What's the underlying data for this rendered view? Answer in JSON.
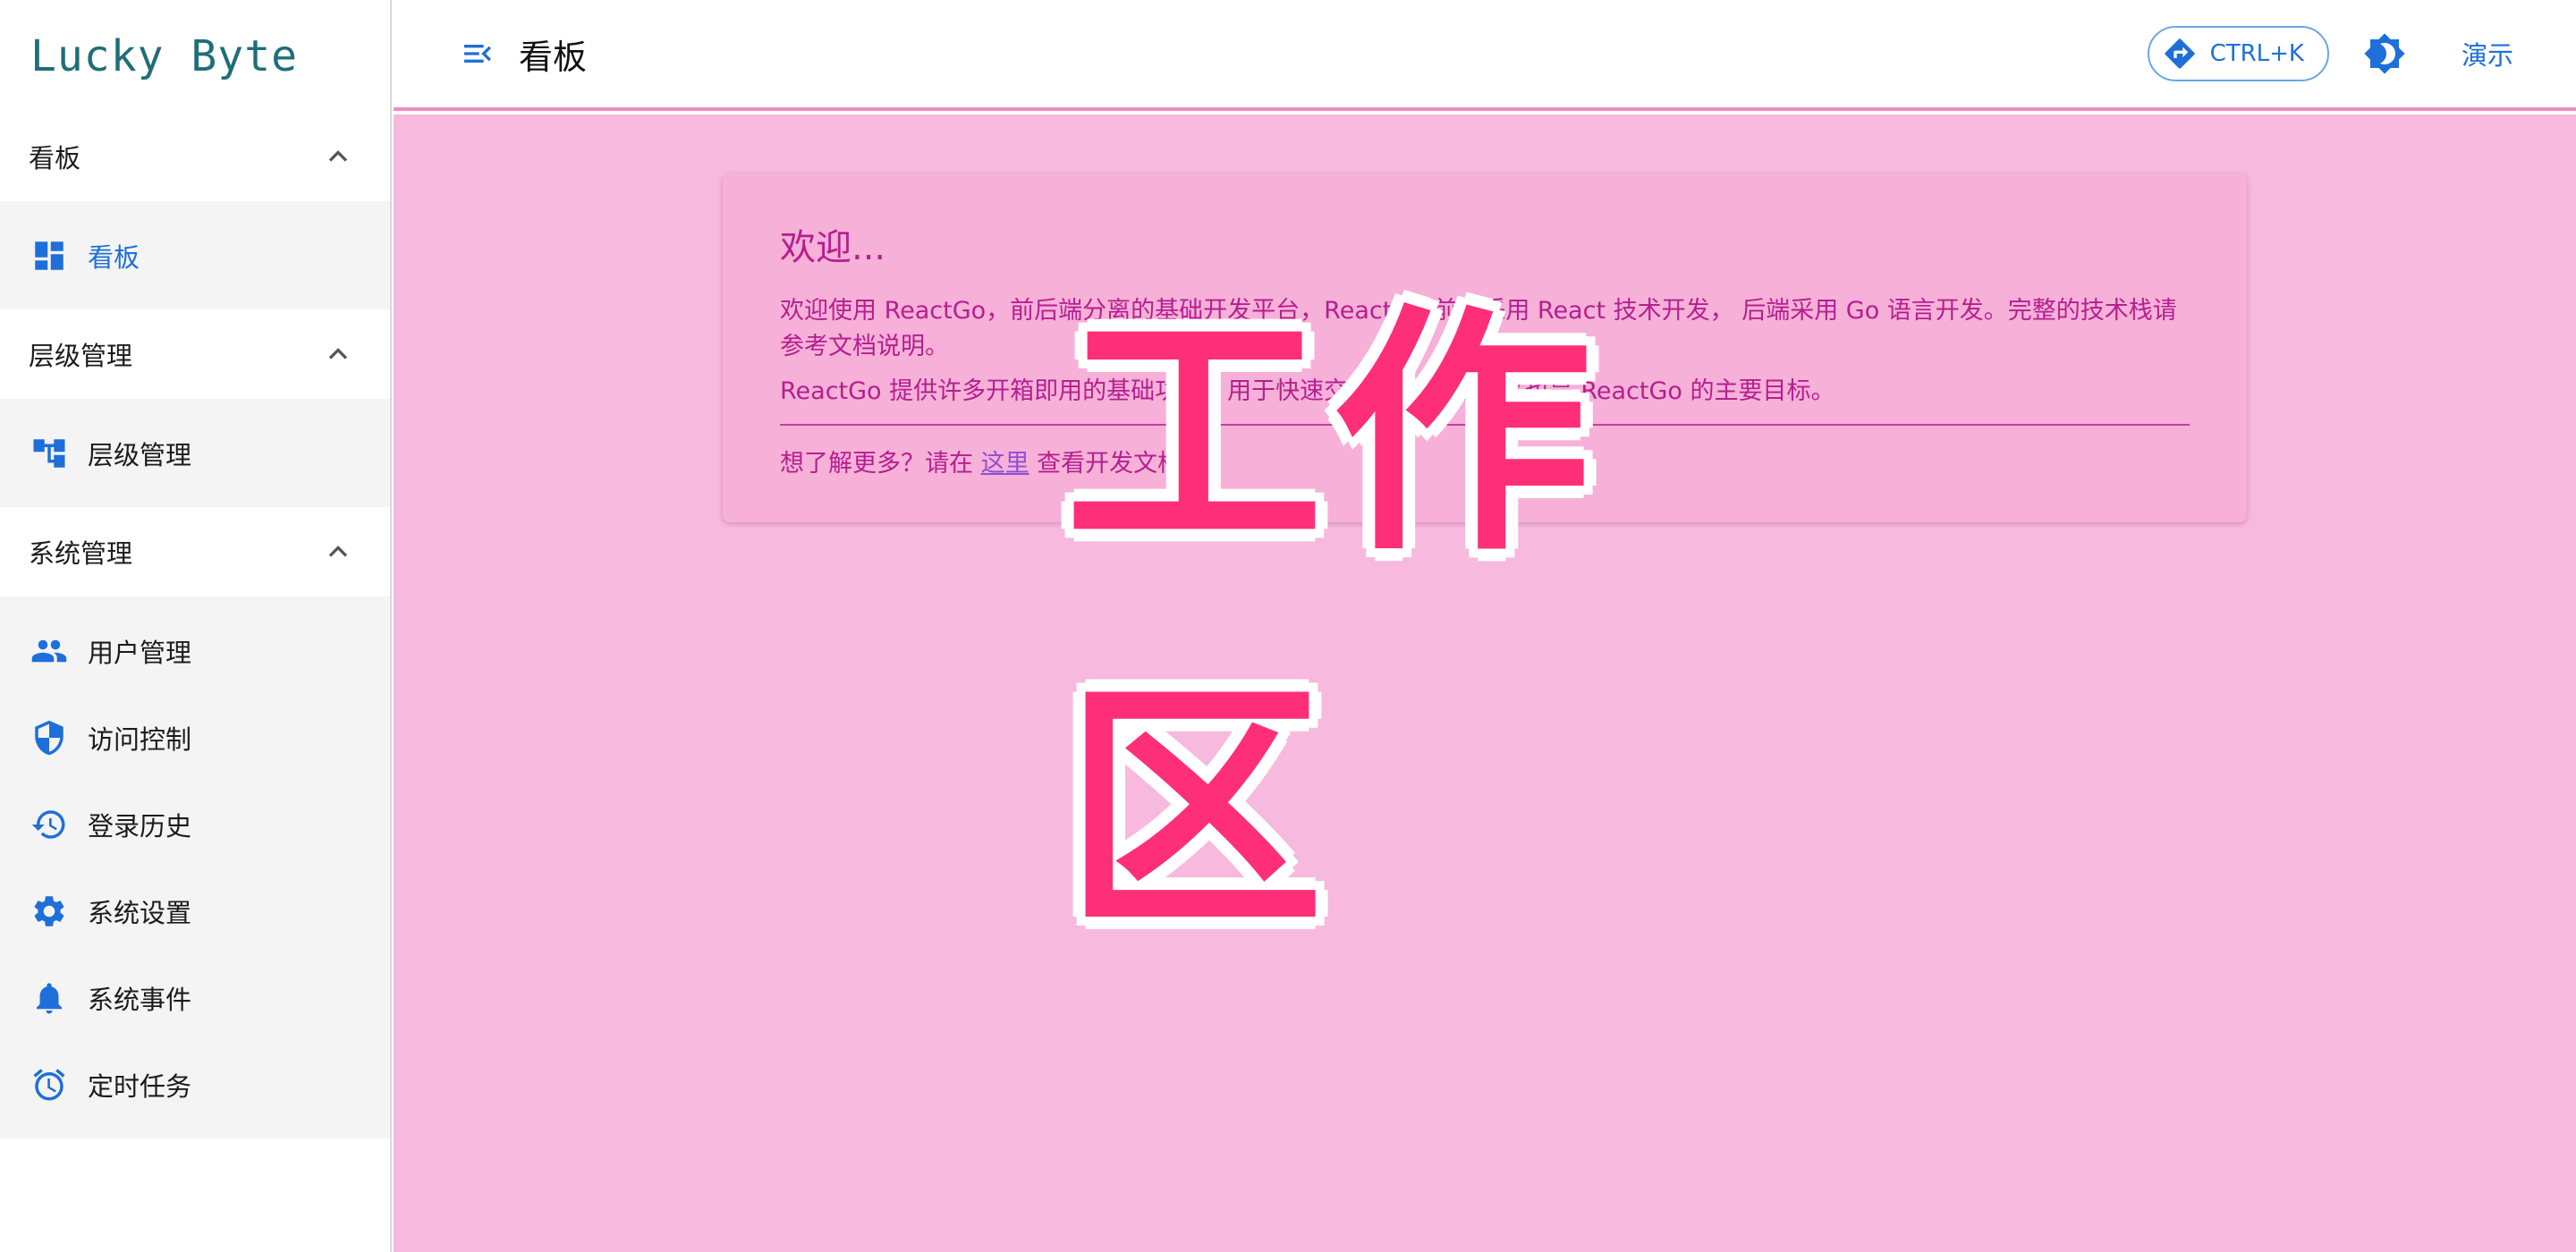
{
  "brand": "Lucky Byte",
  "sidebar": {
    "groups": [
      {
        "title": "看板",
        "items": [
          {
            "label": "看板",
            "icon": "dashboard-icon",
            "active": true
          }
        ]
      },
      {
        "title": "层级管理",
        "items": [
          {
            "label": "层级管理",
            "icon": "hierarchy-icon"
          }
        ]
      },
      {
        "title": "系统管理",
        "items": [
          {
            "label": "用户管理",
            "icon": "users-icon"
          },
          {
            "label": "访问控制",
            "icon": "shield-icon"
          },
          {
            "label": "登录历史",
            "icon": "history-icon"
          },
          {
            "label": "系统设置",
            "icon": "gear-icon"
          },
          {
            "label": "系统事件",
            "icon": "bell-icon"
          },
          {
            "label": "定时任务",
            "icon": "alarm-icon"
          }
        ]
      }
    ]
  },
  "header": {
    "title": "看板",
    "command_label": "CTRL+K",
    "demo_label": "演示"
  },
  "card": {
    "title": "欢迎...",
    "p1": "欢迎使用 ReactGo，前后端分离的基础开发平台，ReactGo 前端采用 React 技术开发， 后端采用 Go 语言开发。完整的技术栈请参考文档说明。",
    "p2": "ReactGo 提供许多开箱即用的基础功能，用于快速交付业务系统， 这也是 ReactGo 的主要目标。",
    "more_prefix": "想了解更多？请在 ",
    "more_link": "这里",
    "more_suffix": " 查看开发文档。"
  },
  "overlay_label": "工作区",
  "colors": {
    "accent": "#1e6fd9",
    "workspace_bg": "#f7b9dd",
    "card_text": "#b41f8f",
    "overlay": "#ff2e78"
  }
}
